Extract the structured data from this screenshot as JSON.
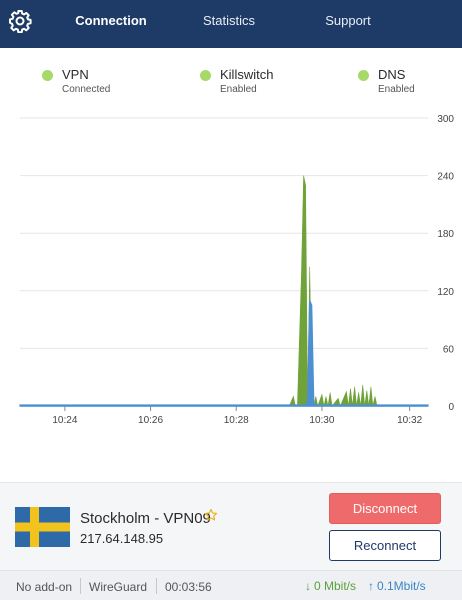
{
  "header": {
    "tabs": [
      {
        "label": "Connection",
        "active": true
      },
      {
        "label": "Statistics",
        "active": false
      },
      {
        "label": "Support",
        "active": false
      }
    ],
    "settings_icon": "gear-icon",
    "background_color": "#1e3a66"
  },
  "status": [
    {
      "name": "VPN",
      "state": "Connected",
      "color": "#a6d96a"
    },
    {
      "name": "Killswitch",
      "state": "Enabled",
      "color": "#a6d96a"
    },
    {
      "name": "DNS",
      "state": "Enabled",
      "color": "#a6d96a"
    }
  ],
  "chart_data": {
    "type": "area",
    "x_ticks": [
      "10:24",
      "10:26",
      "10:28",
      "10:30",
      "10:32"
    ],
    "y_ticks": [
      0,
      60,
      120,
      180,
      240,
      300
    ],
    "ylim": [
      0,
      300
    ],
    "grid": true,
    "series": [
      {
        "color": "#6fa33a",
        "points": [
          [
            0,
            0
          ],
          [
            0.66,
            0
          ],
          [
            0.67,
            10
          ],
          [
            0.675,
            0
          ],
          [
            0.68,
            0
          ],
          [
            0.69,
            140
          ],
          [
            0.695,
            240
          ],
          [
            0.7,
            230
          ],
          [
            0.705,
            0
          ],
          [
            0.71,
            145
          ],
          [
            0.715,
            20
          ],
          [
            0.72,
            0
          ],
          [
            0.725,
            10
          ],
          [
            0.73,
            0
          ],
          [
            0.74,
            12
          ],
          [
            0.745,
            0
          ],
          [
            0.75,
            10
          ],
          [
            0.755,
            0
          ],
          [
            0.76,
            14
          ],
          [
            0.765,
            0
          ],
          [
            0.78,
            8
          ],
          [
            0.785,
            0
          ],
          [
            0.8,
            15
          ],
          [
            0.805,
            0
          ],
          [
            0.81,
            18
          ],
          [
            0.815,
            0
          ],
          [
            0.82,
            20
          ],
          [
            0.825,
            0
          ],
          [
            0.83,
            14
          ],
          [
            0.835,
            0
          ],
          [
            0.84,
            22
          ],
          [
            0.845,
            0
          ],
          [
            0.85,
            16
          ],
          [
            0.855,
            0
          ],
          [
            0.86,
            20
          ],
          [
            0.865,
            0
          ],
          [
            0.87,
            10
          ],
          [
            0.875,
            0
          ],
          [
            1,
            0
          ]
        ]
      },
      {
        "color": "#4e8fd4",
        "points": [
          [
            0,
            1
          ],
          [
            0.7,
            1
          ],
          [
            0.705,
            5
          ],
          [
            0.71,
            110
          ],
          [
            0.715,
            105
          ],
          [
            0.72,
            2
          ],
          [
            0.73,
            1
          ],
          [
            1,
            1
          ]
        ]
      }
    ]
  },
  "server": {
    "country_flag": "sweden-flag",
    "name": "Stockholm - VPN09",
    "ip": "217.64.148.95",
    "favorite_icon": "star-icon",
    "disconnect_label": "Disconnect",
    "reconnect_label": "Reconnect",
    "disconnect_color": "#ef6b6b"
  },
  "footer": {
    "addon": "No add-on",
    "protocol": "WireGuard",
    "duration": "00:03:56",
    "download": "0 Mbit/s",
    "upload": "0.1Mbit/s",
    "download_color": "#5aa03a",
    "upload_color": "#3a86c8"
  }
}
